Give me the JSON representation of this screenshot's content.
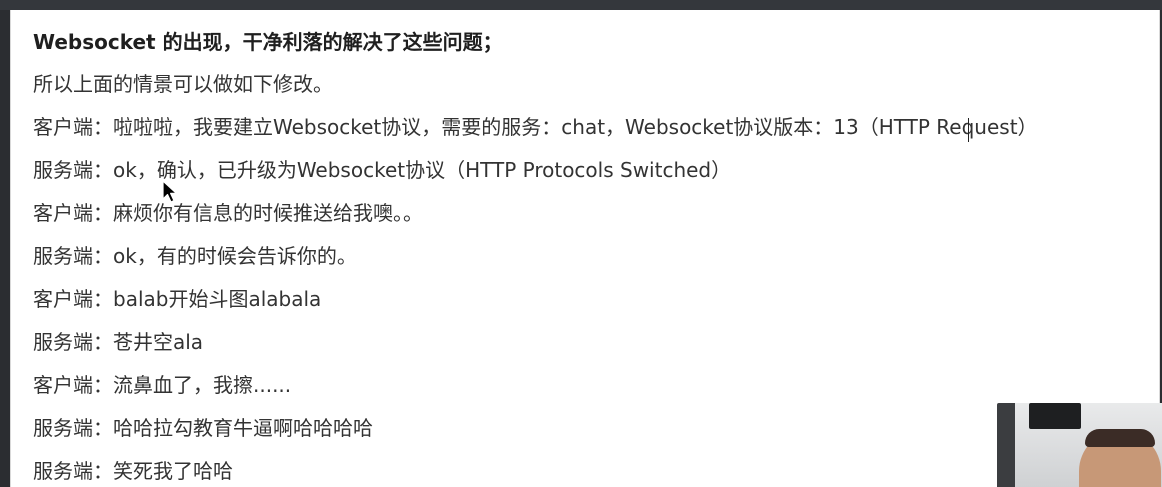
{
  "document": {
    "heading": "Websocket 的出现，干净利落的解决了这些问题；",
    "lines": [
      "所以上面的情景可以做如下修改。",
      "客户端：啦啦啦，我要建立Websocket协议，需要的服务：chat，Websocket协议版本：13（HTTP Request）",
      "服务端：ok，确认，已升级为Websocket协议（HTTP Protocols Switched）",
      "客户端：麻烦你有信息的时候推送给我噢。。",
      "服务端：ok，有的时候会告诉你的。",
      "客户端：balab开始斗图alabala",
      "服务端：苍井空ala",
      "客户端：流鼻血了，我擦......",
      "服务端：哈哈拉勾教育牛逼啊哈哈哈哈",
      "服务端：笑死我了哈哈"
    ]
  },
  "overlays": {
    "cursor_icon": "mouse-pointer-icon",
    "webcam": "presenter-webcam-feed"
  }
}
